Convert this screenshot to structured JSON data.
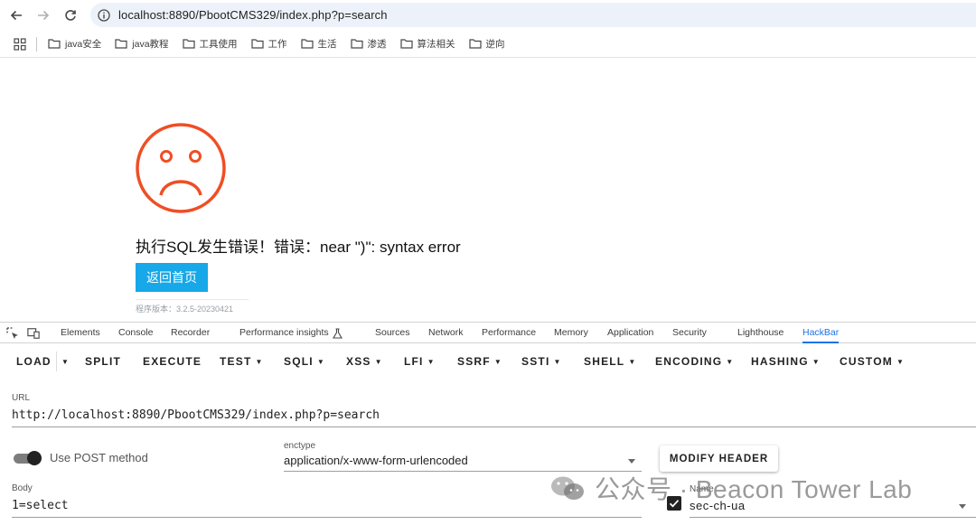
{
  "browser": {
    "url": "localhost:8890/PbootCMS329/index.php?p=search"
  },
  "bookmarks": [
    {
      "label": "java安全"
    },
    {
      "label": "java教程"
    },
    {
      "label": "工具使用"
    },
    {
      "label": "工作"
    },
    {
      "label": "生活"
    },
    {
      "label": "渗透"
    },
    {
      "label": "算法相关"
    },
    {
      "label": "逆向"
    }
  ],
  "page": {
    "error_message": "执行SQL发生错误！错误：near \")\": syntax error",
    "back_button": "返回首页",
    "version": "程序版本：3.2.5-20230421",
    "accent_color": "#f04e23"
  },
  "devtools": {
    "tabs": [
      "Elements",
      "Console",
      "Recorder",
      "Performance insights",
      "Sources",
      "Network",
      "Performance",
      "Memory",
      "Application",
      "Security",
      "Lighthouse",
      "HackBar"
    ],
    "active_tab": "HackBar"
  },
  "hackbar": {
    "toolbar": [
      "LOAD",
      "SPLIT",
      "EXECUTE",
      "TEST",
      "SQLI",
      "XSS",
      "LFI",
      "SSRF",
      "SSTI",
      "SHELL",
      "ENCODING",
      "HASHING",
      "CUSTOM"
    ],
    "url_label": "URL",
    "url_value": "http://localhost:8890/PbootCMS329/index.php?p=search",
    "post_label": "Use POST method",
    "enctype_label": "enctype",
    "enctype_value": "application/x-www-form-urlencoded",
    "modify_header": "MODIFY HEADER",
    "body_label": "Body",
    "body_value": "1=select",
    "name_label": "Name",
    "header_name": "sec-ch-ua"
  },
  "watermark": {
    "text": "公众号 · Beacon Tower Lab"
  }
}
